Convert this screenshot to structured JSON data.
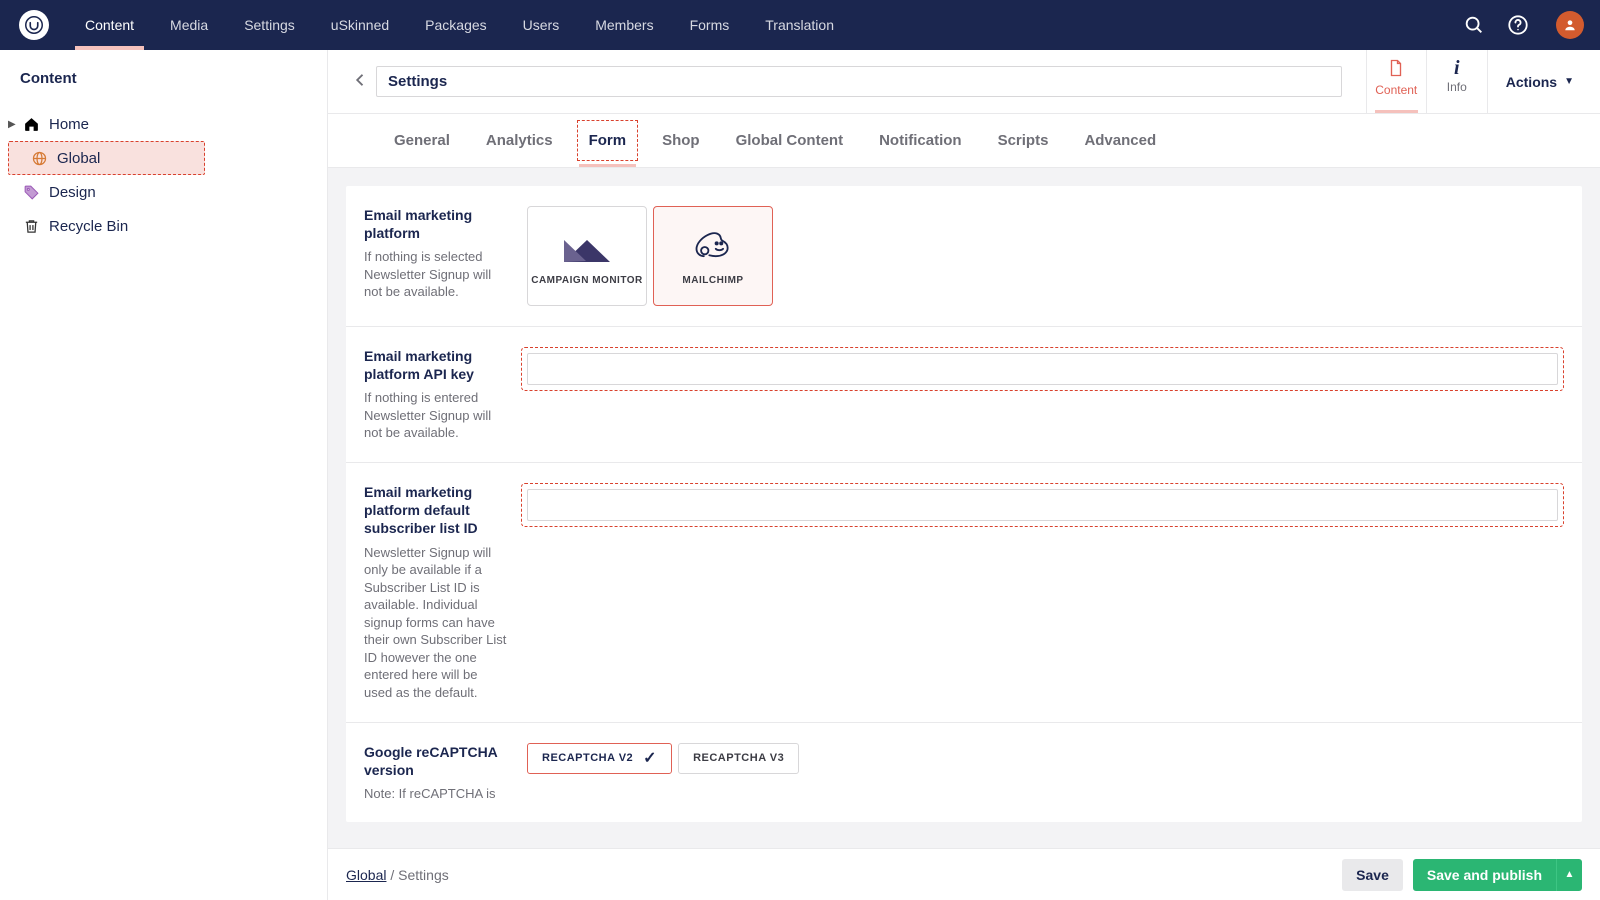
{
  "topnav": {
    "items": [
      "Content",
      "Media",
      "Settings",
      "uSkinned",
      "Packages",
      "Users",
      "Members",
      "Forms",
      "Translation"
    ],
    "active": 0
  },
  "tree": {
    "title": "Content",
    "items": [
      {
        "label": "Home",
        "icon": "home",
        "level": 1,
        "expandable": true
      },
      {
        "label": "Global",
        "icon": "globe",
        "level": 2,
        "active": true
      },
      {
        "label": "Design",
        "icon": "tag",
        "level": 2
      },
      {
        "label": "Recycle Bin",
        "icon": "trash",
        "level": 2
      }
    ]
  },
  "editor": {
    "title": "Settings",
    "apps": [
      {
        "label": "Content",
        "icon": "doc",
        "active": true
      },
      {
        "label": "Info",
        "icon": "info"
      }
    ],
    "actions_label": "Actions"
  },
  "subtabs": {
    "items": [
      "General",
      "Analytics",
      "Form",
      "Shop",
      "Global Content",
      "Notification",
      "Scripts",
      "Advanced"
    ],
    "active": 2
  },
  "form": {
    "platform": {
      "label": "Email marketing platform",
      "hint": "If nothing is selected Newsletter Signup will not be available.",
      "options": [
        {
          "label": "CAMPAIGN MONITOR",
          "key": "campaignmonitor"
        },
        {
          "label": "MAILCHIMP",
          "key": "mailchimp",
          "selected": true
        }
      ]
    },
    "apikey": {
      "label": "Email marketing platform API key",
      "hint": "If nothing is entered Newsletter Signup will not be available.",
      "value": ""
    },
    "listid": {
      "label": "Email marketing platform default subscriber list ID",
      "hint": "Newsletter Signup will only be available if a Subscriber List ID is available. Individual signup forms can have their own Subscriber List ID however the one entered here will be used as the default.",
      "value": ""
    },
    "recaptcha": {
      "label": "Google reCAPTCHA version",
      "hint_truncated": "Note: If reCAPTCHA is",
      "options": [
        {
          "label": "RECAPTCHA V2",
          "selected": true
        },
        {
          "label": "RECAPTCHA V3"
        }
      ]
    }
  },
  "footer": {
    "crumb_link": "Global",
    "crumb_current": "Settings",
    "save": "Save",
    "publish": "Save and publish"
  }
}
